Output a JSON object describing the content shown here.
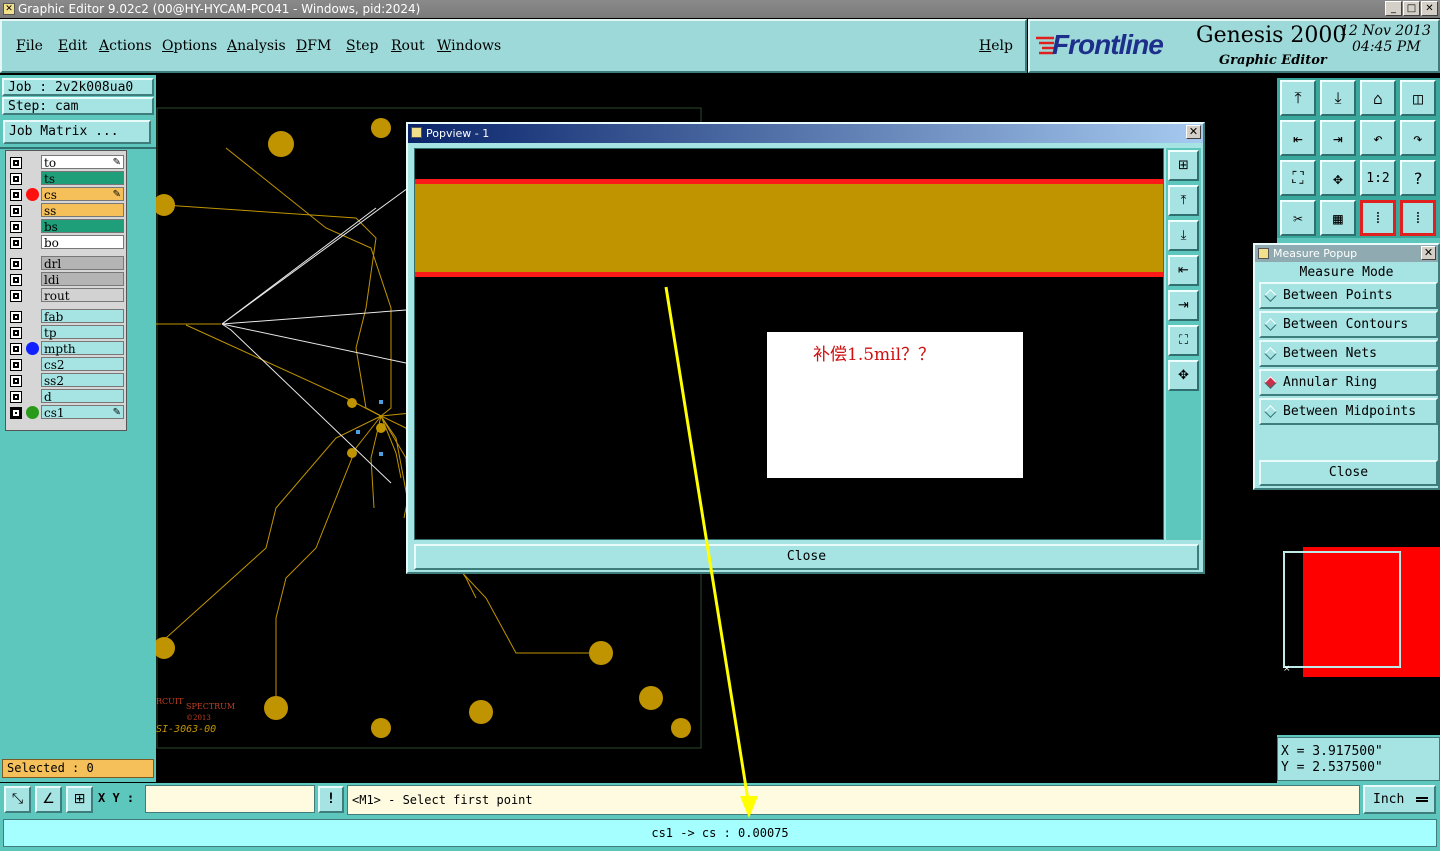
{
  "window": {
    "title": "Graphic Editor 9.02c2 (00@HY-HYCAM-PC041 - Windows, pid:2024)",
    "btn_min": "_",
    "btn_max": "□",
    "btn_close": "✕"
  },
  "menu": {
    "items": [
      "File",
      "Edit",
      "Actions",
      "Options",
      "Analysis",
      "DFM",
      "Step",
      "Rout",
      "Windows"
    ],
    "help": "Help"
  },
  "logo": {
    "brand": "Frontline",
    "product": "Genesis 2000",
    "subtitle": "Graphic Editor",
    "date": "12 Nov 2013",
    "time": "04:45 PM"
  },
  "job": {
    "job_label": "Job : 2v2k008ua0",
    "step_label": "Step: cam",
    "matrix_button": "Job Matrix ..."
  },
  "layers": [
    {
      "name": "to",
      "color": "#ffffff",
      "dot": "",
      "pen": true
    },
    {
      "name": "ts",
      "color": "#1f9e7a",
      "dot": "",
      "pen": false
    },
    {
      "name": "cs",
      "color": "#f5c05a",
      "dot": "#ff1010",
      "pen": true
    },
    {
      "name": "ss",
      "color": "#f5c05a",
      "dot": "",
      "pen": false
    },
    {
      "name": "bs",
      "color": "#1f9e7a",
      "dot": "",
      "pen": false
    },
    {
      "name": "bo",
      "color": "#ffffff",
      "dot": "",
      "pen": false
    },
    {
      "name": "drl",
      "color": "#b4b4b4",
      "dot": "",
      "pen": false
    },
    {
      "name": "ldi",
      "color": "#b4b4b4",
      "dot": "",
      "pen": false
    },
    {
      "name": "rout",
      "color": "#d2d2d2",
      "dot": "",
      "pen": false
    },
    {
      "name": "fab",
      "color": "#a6e3e3",
      "dot": "",
      "pen": false
    },
    {
      "name": "tp",
      "color": "#a6e3e3",
      "dot": "",
      "pen": false
    },
    {
      "name": "mpth",
      "color": "#a6e3e3",
      "dot": "#1020ff",
      "pen": false
    },
    {
      "name": "cs2",
      "color": "#a6e3e3",
      "dot": "",
      "pen": false
    },
    {
      "name": "ss2",
      "color": "#a6e3e3",
      "dot": "",
      "pen": false
    },
    {
      "name": "d",
      "color": "#a6e3e3",
      "dot": "",
      "pen": false
    },
    {
      "name": "cs1",
      "color": "#a6e3e3",
      "dot": "#2a9a1a",
      "pen": true,
      "selected": true
    }
  ],
  "pen_glyph": "✎",
  "selected_label": "Selected : 0",
  "popview": {
    "title": "Popview - 1",
    "annotation": "补偿1.5mil？？",
    "close": "Close"
  },
  "measure": {
    "title": "Measure Popup",
    "header": "Measure Mode",
    "options": [
      "Between Points",
      "Between Contours",
      "Between Nets",
      "Annular Ring",
      "Between Midpoints"
    ],
    "active_index": 3,
    "close": "Close"
  },
  "toolbar_icons": [
    "page-up-icon",
    "page-down-icon",
    "home-icon",
    "split-view-icon",
    "pan-left-icon",
    "pan-right-icon",
    "undo-view-icon",
    "redo-view-icon",
    "fit-all-icon",
    "zoom-center-icon",
    "scale-1-2-icon",
    "help-question-icon",
    "measure-tools-icon",
    "grid-icon",
    "layer-net-icon",
    "snap-net-icon"
  ],
  "toolbar_glyphs": [
    "⤒",
    "⤓",
    "⌂",
    "◫",
    "⇤",
    "⇥",
    "↶",
    "↷",
    "⛶",
    "✥",
    "1:2",
    "?",
    "✂",
    "▦",
    "⁞",
    "⁞"
  ],
  "popview_glyphs": [
    "⊞",
    "⤒",
    "⤓",
    "⇤",
    "⇥",
    "⛶",
    "✥"
  ],
  "coords": {
    "x": "X = 3.917500\"",
    "y": "Y = 2.537500\""
  },
  "board": {
    "copyright_l": "RCUIT",
    "copyright_r": "SPECTRUM",
    "copyright_year": "©2013",
    "part": "SI-3063-00"
  },
  "bottom": {
    "xy_label": "X Y :",
    "xy_value": "",
    "alert": "!",
    "prompt": "<M1> - Select first point",
    "units": "Inch",
    "status": "cs1 -> cs : 0.00075"
  },
  "colors": {
    "panel": "#a6e3e3",
    "accent": "#5ec7bd",
    "copper": "#c09400",
    "annotation": "#d01010",
    "arrow": "#ffff00"
  }
}
